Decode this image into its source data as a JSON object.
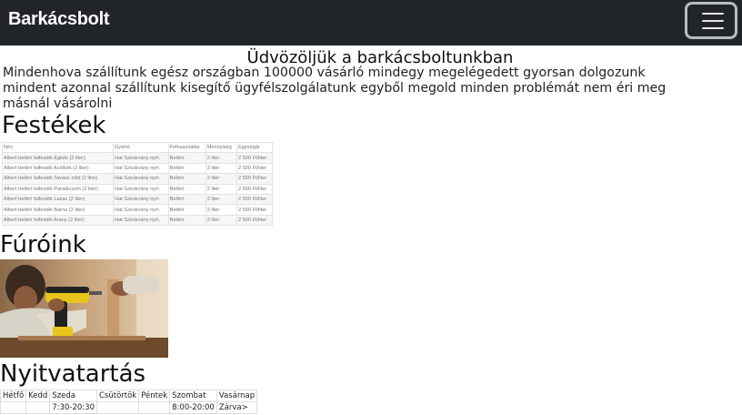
{
  "navbar": {
    "brand": "Barkácsbolt",
    "toggler_icon": "hamburger-menu-icon"
  },
  "welcome": "Üdvözöljük a barkácsboltunkban",
  "intro": "Mindenhova szállítunk egész országban 100000 vásárló mindegy megelégedett gyorsan dolgozunk mindent azonnal szállítunk kisegítő ügyfélszolgálatunk egyből megold minden problémát nem éri meg másnál vásárolni",
  "paints": {
    "heading": "Festékek",
    "columns": [
      "Név",
      "Gyártó",
      "Felhasználás",
      "Mennyiség",
      "Egységár"
    ],
    "rows": [
      [
        "Albert beltéri falfesték Égkék (2 liter)",
        "Hat Szivárvány nyrt.",
        "Beltéri",
        "2 liter",
        "2 500 Ft/liter"
      ],
      [
        "Albert beltéri falfesték Acélkék (2 liter)",
        "Hat Szivárvány nyrt.",
        "Beltéri",
        "2 liter",
        "2 500 Ft/liter"
      ],
      [
        "Albert beltéri falfesték Tavasz zöld (2 liter)",
        "Hat Szivárvány nyrt.",
        "Beltéri",
        "2 liter",
        "2 500 Ft/liter"
      ],
      [
        "Albert beltéri falfesték Paradicsom (2 liter)",
        "Hat Szivárvány nyrt.",
        "Beltéri",
        "2 liter",
        "2 500 Ft/liter"
      ],
      [
        "Albert beltéri falfesték Lazac (2 liter)",
        "Hat Szivárvány nyrt.",
        "Beltéri",
        "2 liter",
        "2 500 Ft/liter"
      ],
      [
        "Albert beltéri falfesték Barna (2 liter)",
        "Hat Szivárvány nyrt.",
        "Beltéri",
        "2 liter",
        "2 500 Ft/liter"
      ],
      [
        "Albert beltéri falfesték Arany (2 liter)",
        "Hat Szivárvány nyrt.",
        "Beltéri",
        "2 liter",
        "2 500 Ft/liter"
      ]
    ]
  },
  "drills": {
    "heading": "Fúróink"
  },
  "hours": {
    "heading": "Nyitvatartás",
    "days": [
      "Hétfő",
      "Kedd",
      "Szeda",
      "Csütörtök",
      "Péntek",
      "Szombat",
      "Vasárnap"
    ],
    "times": [
      "",
      "",
      "7:30-20:30",
      "",
      "",
      "8:00-20:00",
      "Zárva>"
    ]
  }
}
